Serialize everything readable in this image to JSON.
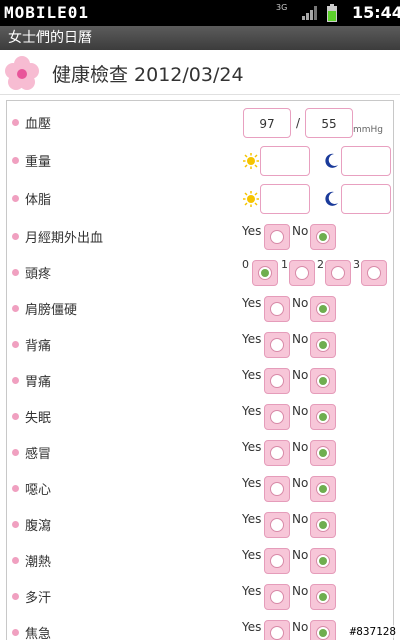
{
  "status_bar": {
    "brand": "MOBILE01",
    "network": "3G",
    "time": "15:44"
  },
  "app": {
    "title": "女士們的日曆"
  },
  "header": {
    "title": "健康檢查 2012/03/24"
  },
  "rows": {
    "blood_pressure": {
      "label": "血壓",
      "systolic": "97",
      "separator": "/",
      "diastolic": "55",
      "unit": "mmHg"
    },
    "weight": {
      "label": "重量",
      "morning": "",
      "night": ""
    },
    "body_fat": {
      "label": "体脂",
      "morning": "",
      "night": ""
    },
    "spotting": {
      "label": "月經期外出血",
      "yes": "Yes",
      "no": "No",
      "value": "No"
    },
    "headache": {
      "label": "頭疼",
      "scale": [
        "0",
        "1",
        "2",
        "3"
      ],
      "value": "0"
    },
    "stiff_shoulders": {
      "label": "肩膀僵硬",
      "yes": "Yes",
      "no": "No",
      "value": "No"
    },
    "back_pain": {
      "label": "背痛",
      "yes": "Yes",
      "no": "No",
      "value": "No"
    },
    "stomach_ache": {
      "label": "胃痛",
      "yes": "Yes",
      "no": "No",
      "value": "No"
    },
    "insomnia": {
      "label": "失眠",
      "yes": "Yes",
      "no": "No",
      "value": "No"
    },
    "cold": {
      "label": "感冒",
      "yes": "Yes",
      "no": "No",
      "value": "No"
    },
    "nausea": {
      "label": "噁心",
      "yes": "Yes",
      "no": "No",
      "value": "No"
    },
    "diarrhea": {
      "label": "腹瀉",
      "yes": "Yes",
      "no": "No",
      "value": "No"
    },
    "hot_flashes": {
      "label": "潮熱",
      "yes": "Yes",
      "no": "No",
      "value": "No"
    },
    "sweating": {
      "label": "多汗",
      "yes": "Yes",
      "no": "No",
      "value": "No"
    },
    "anxiety": {
      "label": "焦急",
      "yes": "Yes",
      "no": "No",
      "value": "No"
    }
  },
  "watermark": "#837128",
  "colors": {
    "accent_pink": "#f7c6d8",
    "check_green": "#6fae4f"
  }
}
